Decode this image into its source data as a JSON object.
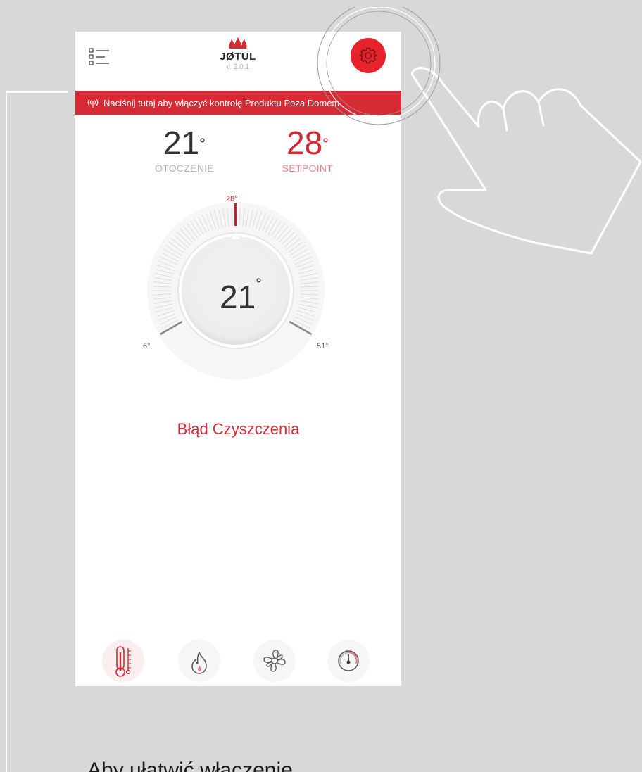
{
  "header": {
    "brand": "JØTUL",
    "version": "v. 2.0.1",
    "menu_icon": "list-menu-icon",
    "settings_icon": "gear-icon",
    "accent_color": "#e8222a"
  },
  "banner": {
    "text": "Naciśnij tutaj aby włączyć kontrolę Produktu Poza Domem",
    "icon": "wireless-signal-icon",
    "color": "#d62b35"
  },
  "temps": {
    "ambient_value": "21",
    "ambient_label": "OTOCZENIE",
    "setpoint_value": "28",
    "setpoint_label": "SETPOINT",
    "degree": "°"
  },
  "dial": {
    "current": "21",
    "setpoint_label": "28°",
    "min_label": "6°",
    "max_label": "51°",
    "min": 6,
    "max": 51,
    "setpoint": 28
  },
  "status": {
    "text": "Błąd Czyszczenia"
  },
  "nav": [
    {
      "name": "thermometer-icon",
      "active": true
    },
    {
      "name": "flame-icon",
      "active": false
    },
    {
      "name": "fan-icon",
      "active": false
    },
    {
      "name": "gauge-icon",
      "active": false
    }
  ],
  "caption": "Aby ułatwić włączenie"
}
